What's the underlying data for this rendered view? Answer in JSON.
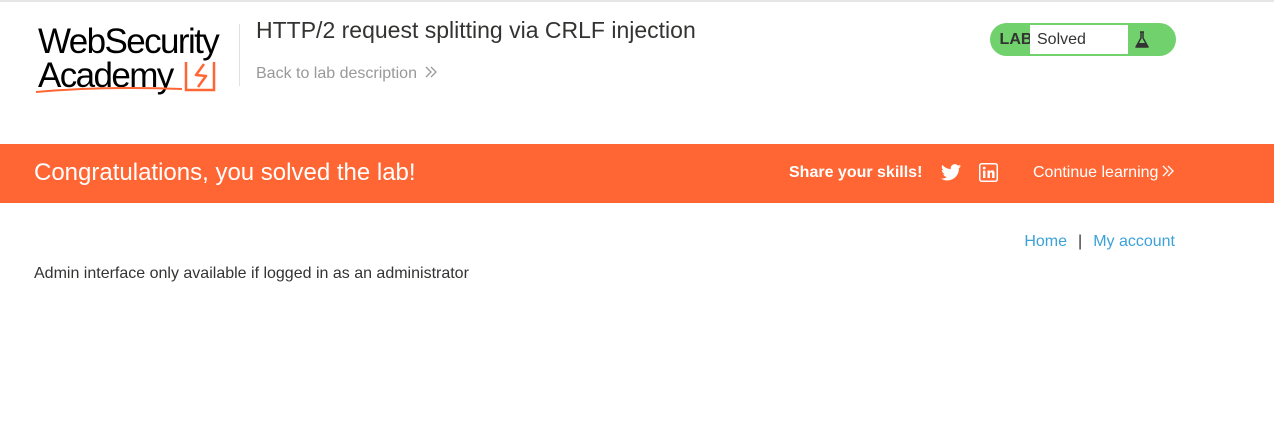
{
  "header": {
    "logo_line1": "WebSecurity",
    "logo_line2": "Academy",
    "lab_title": "HTTP/2 request splitting via CRLF injection",
    "back_link": "Back to lab description",
    "lab_badge": {
      "label": "LAB",
      "status": "Solved",
      "color": "#70d16d"
    }
  },
  "banner": {
    "message": "Congratulations, you solved the lab!",
    "share_label": "Share your skills!",
    "continue_label": "Continue learning",
    "color": "#ff6633"
  },
  "nav": {
    "home": "Home",
    "separator": "|",
    "my_account": "My account"
  },
  "content": {
    "message": "Admin interface only available if logged in as an administrator"
  },
  "icons": [
    "logo-bolt-icon",
    "chevron-double-right-icon",
    "flask-icon",
    "twitter-icon",
    "linkedin-icon"
  ]
}
